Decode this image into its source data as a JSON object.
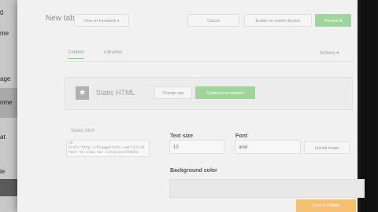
{
  "background_sidebar": {
    "items": [
      "0",
      "me",
      "age",
      "ome",
      "at",
      "ie"
    ]
  },
  "editor": {
    "title": "New tab",
    "header_buttons": {
      "view_on_facebook": "View on Facebook ▾",
      "cancel": "Cancel",
      "enable_mobile": "Enable on mobile devices",
      "preview": "Preview ⧉"
    },
    "tabs": {
      "content": "Content",
      "libraries": "Libraries",
      "actions": "Actions ▾"
    },
    "widget": {
      "label": "Static HTML",
      "change_app": "Change app",
      "content_source": "Content your website"
    },
    "fields": {
      "select_html_label": "Select html",
      "html_value": "<a href=\"http://bloggertuts.com\">Click here to view our site</a></html>",
      "text_size_label": "Text size",
      "text_size_value": "12",
      "font_label": "Font",
      "font_value": "arial",
      "upload_image": "Upload image",
      "background_color_label": "Background color"
    },
    "save_button": "Save & Publish"
  },
  "colors": {
    "accent_green": "#9fd59b",
    "orange": "#f4c070"
  }
}
